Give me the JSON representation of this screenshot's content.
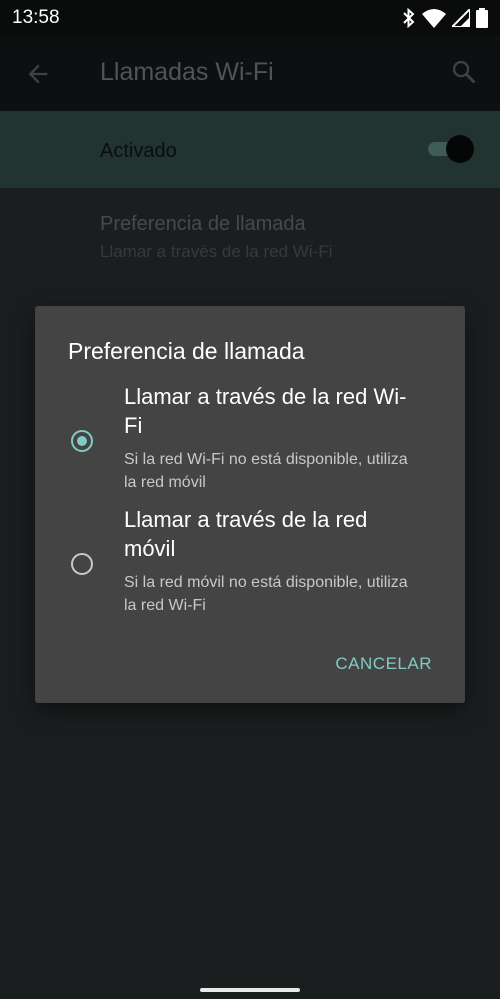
{
  "status_bar": {
    "time": "13:58",
    "icons": [
      "bluetooth-icon",
      "wifi-icon",
      "signal-icon",
      "battery-icon"
    ]
  },
  "app_bar": {
    "title": "Llamadas Wi-Fi",
    "back_icon": "arrow-left-icon",
    "search_icon": "search-icon"
  },
  "master_switch": {
    "label": "Activado",
    "enabled": true
  },
  "preference": {
    "title": "Preferencia de llamada",
    "summary": "Llamar a través de la red Wi-Fi"
  },
  "dialog": {
    "title": "Preferencia de llamada",
    "options": [
      {
        "title": "Llamar a través de la red Wi-Fi",
        "subtitle": "Si la red Wi-Fi no está disponible, utiliza la red móvil",
        "selected": true
      },
      {
        "title": "Llamar a través de la red móvil",
        "subtitle": "Si la red móvil no está disponible, utiliza la red Wi-Fi",
        "selected": false
      }
    ],
    "cancel_label": "CANCELAR"
  },
  "colors": {
    "accent": "#80cbc4",
    "dialog_bg": "#444444",
    "screen_bg": "#1b1e1f"
  }
}
